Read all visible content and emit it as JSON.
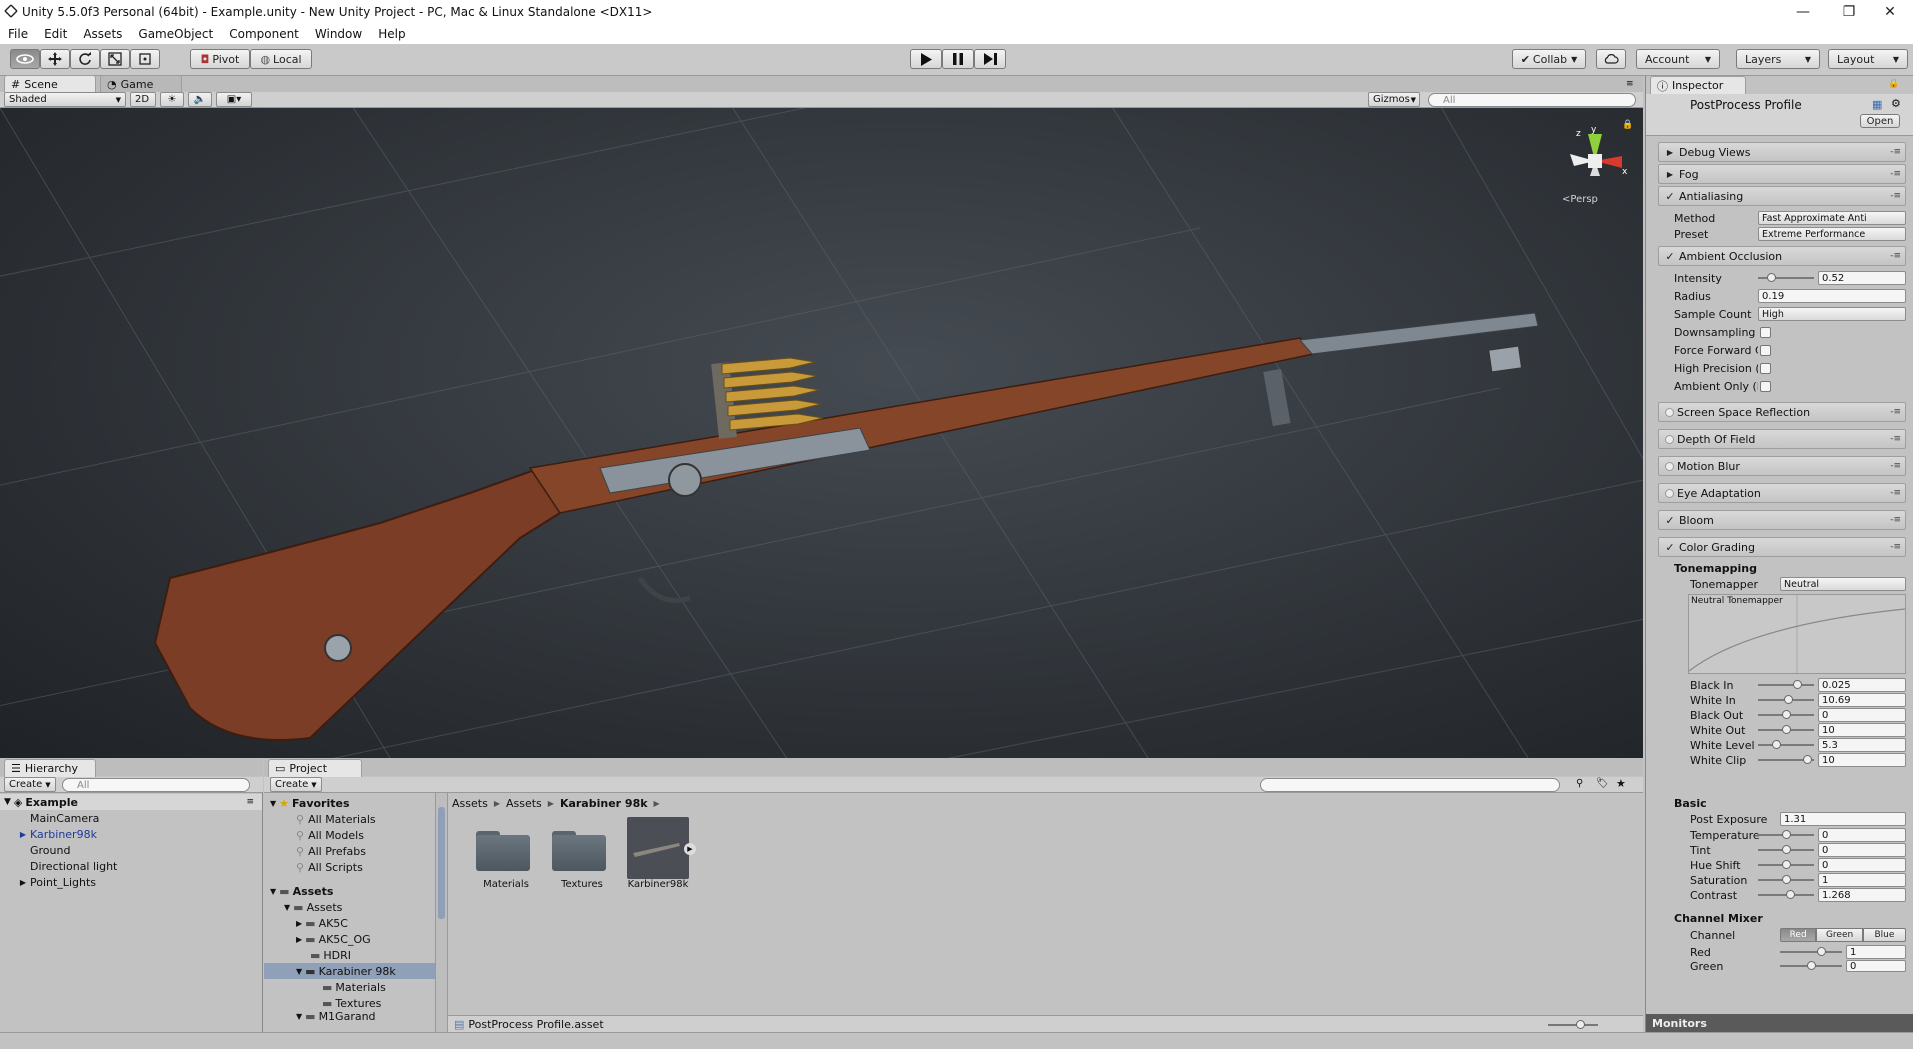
{
  "window": {
    "title": "Unity 5.5.0f3 Personal (64bit) - Example.unity - New Unity Project - PC, Mac & Linux Standalone <DX11>",
    "minimize": "—",
    "maximize": "❐",
    "close": "✕"
  },
  "menu": [
    "File",
    "Edit",
    "Assets",
    "GameObject",
    "Component",
    "Window",
    "Help"
  ],
  "toolbar": {
    "pivot": "Pivot",
    "local": "Local",
    "collab": "Collab",
    "account": "Account",
    "layers": "Layers",
    "layout": "Layout"
  },
  "scene_panel": {
    "tab_scene": "Scene",
    "tab_game": "Game",
    "shading": "Shaded",
    "mode_2d": "2D",
    "gizmos": "Gizmos",
    "search_placeholder": "All",
    "persp_label": "Persp",
    "gizmo_axes": {
      "x": "x",
      "y": "y",
      "z": "z"
    }
  },
  "hierarchy": {
    "tab": "Hierarchy",
    "create": "Create",
    "search_placeholder": "All",
    "scene_name": "Example",
    "items": [
      {
        "label": "MainCamera",
        "arrow": ""
      },
      {
        "label": "Karbiner98k",
        "arrow": "▶"
      },
      {
        "label": "Ground",
        "arrow": ""
      },
      {
        "label": "Directional light",
        "arrow": ""
      },
      {
        "label": "Point_Lights",
        "arrow": "▶"
      }
    ]
  },
  "project": {
    "tab": "Project",
    "create": "Create",
    "favorites_label": "Favorites",
    "favorites": [
      "All Materials",
      "All Models",
      "All Prefabs",
      "All Scripts"
    ],
    "assets_label": "Assets",
    "tree": [
      {
        "label": "Assets",
        "depth": 1
      },
      {
        "label": "AK5C",
        "depth": 2
      },
      {
        "label": "AK5C_OG",
        "depth": 2
      },
      {
        "label": "HDRI",
        "depth": 2
      },
      {
        "label": "Karabiner 98k",
        "depth": 2
      },
      {
        "label": "Materials",
        "depth": 3
      },
      {
        "label": "Textures",
        "depth": 3
      },
      {
        "label": "M1Garand",
        "depth": 2
      }
    ],
    "breadcrumb": [
      "Assets",
      "Assets",
      "Karabiner 98k"
    ],
    "grid_items": [
      "Materials",
      "Textures",
      "Karbiner98k"
    ],
    "selected_file": "PostProcess Profile.asset"
  },
  "inspector": {
    "tab": "Inspector",
    "asset_title": "PostProcess Profile",
    "open_button": "Open",
    "sections": {
      "debug_views": "Debug Views",
      "fog": "Fog",
      "antialiasing": "Antialiasing",
      "ambient_occlusion": "Ambient Occlusion",
      "ssr": "Screen Space Reflection",
      "dof": "Depth Of Field",
      "motion_blur": "Motion Blur",
      "eye_adaptation": "Eye Adaptation",
      "bloom": "Bloom",
      "color_grading": "Color Grading"
    },
    "antialiasing": {
      "method_label": "Method",
      "method_value": "Fast Approximate Anti",
      "preset_label": "Preset",
      "preset_value": "Extreme Performance"
    },
    "ao": {
      "intensity_label": "Intensity",
      "intensity_value": "0.52",
      "intensity_level": 0.2,
      "radius_label": "Radius",
      "radius_value": "0.19",
      "sample_count_label": "Sample Count",
      "sample_count_value": "High",
      "downsampling_label": "Downsampling",
      "force_forward_label": "Force Forward Co",
      "high_precision_label": "High Precision (Fo",
      "ambient_only_label": "Ambient Only (De"
    },
    "tonemapping": {
      "heading": "Tonemapping",
      "tonemapper_label": "Tonemapper",
      "tonemapper_value": "Neutral",
      "curve_title": "Neutral Tonemapper",
      "rows": [
        {
          "label": "Black In",
          "value": "0.025",
          "level": 0.75
        },
        {
          "label": "White In",
          "value": "10.69",
          "level": 0.55
        },
        {
          "label": "Black Out",
          "value": "0",
          "level": 0.5
        },
        {
          "label": "White Out",
          "value": "10",
          "level": 0.5
        },
        {
          "label": "White Level",
          "value": "5.3",
          "level": 0.3
        },
        {
          "label": "White Clip",
          "value": "10",
          "level": 0.95
        }
      ]
    },
    "basic": {
      "heading": "Basic",
      "post_exposure_label": "Post Exposure",
      "post_exposure_value": "1.31",
      "rows": [
        {
          "label": "Temperature",
          "value": "0",
          "level": 0.5
        },
        {
          "label": "Tint",
          "value": "0",
          "level": 0.5
        },
        {
          "label": "Hue Shift",
          "value": "0",
          "level": 0.5
        },
        {
          "label": "Saturation",
          "value": "1",
          "level": 0.5
        },
        {
          "label": "Contrast",
          "value": "1.268",
          "level": 0.6
        }
      ]
    },
    "channel_mixer": {
      "heading": "Channel Mixer",
      "channel_label": "Channel",
      "channels": [
        "Red",
        "Green",
        "Blue"
      ],
      "red_label": "Red",
      "red_value": "1",
      "red_level": 0.7,
      "green_label": "Green",
      "green_value": "0",
      "green_level": 0.5
    },
    "monitors": "Monitors"
  }
}
